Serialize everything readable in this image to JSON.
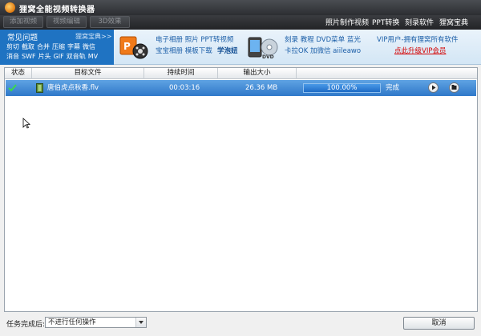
{
  "window": {
    "title": "狸窝全能视频转换器",
    "icon": "fox-app-icon"
  },
  "toolbar": {
    "buttons": [
      "添加视频",
      "视频编辑",
      "3D效果"
    ],
    "links": [
      "照片制作视频",
      "PPT转换",
      "刻录软件",
      "狸窝宝典"
    ]
  },
  "banner": {
    "faq_title": "常见问题",
    "faq_more": "狸窝宝典>>",
    "faq_row1": [
      "剪切",
      "截取",
      "合并",
      "压缩",
      "字幕",
      "微信"
    ],
    "faq_row2": [
      "消音",
      "SWF",
      "片头",
      "GIF",
      "双音轨",
      "MV"
    ],
    "group1_row1": "电子相册 照片 PPT转视频",
    "group1_row2_a": "宝宝相册 模板下载",
    "group1_row2_b": "学泡妞",
    "group2_row1": "刻录 教程 DVD菜单 蓝光",
    "group2_row2": "卡拉OK 加微信 aiileawo",
    "vip_line1": "VIP用户-拥有狸窝所有软件",
    "vip_line2": "点此升级VIP会员",
    "vip_link_color": "#d40000"
  },
  "table": {
    "headers": [
      "状态",
      "目标文件",
      "持续时间",
      "输出大小"
    ],
    "rows": [
      {
        "status_icon": "checkmark-icon",
        "file_icon": "film-file-icon",
        "filename": "唐伯虎点秋香.flv",
        "duration": "00:03:16",
        "size": "26.36 MB",
        "progress": 1.0,
        "progress_text": "100.00%",
        "state": "完成",
        "action_icons": [
          "play-icon",
          "folder-icon"
        ]
      }
    ]
  },
  "footer": {
    "label": "任务完成后:",
    "select_value": "不进行任何操作",
    "cancel_label": "取消"
  },
  "colors": {
    "row_selected": "#2f78c9",
    "faq_panel": "#1f73c2",
    "titlebar": "#2c2e32"
  }
}
